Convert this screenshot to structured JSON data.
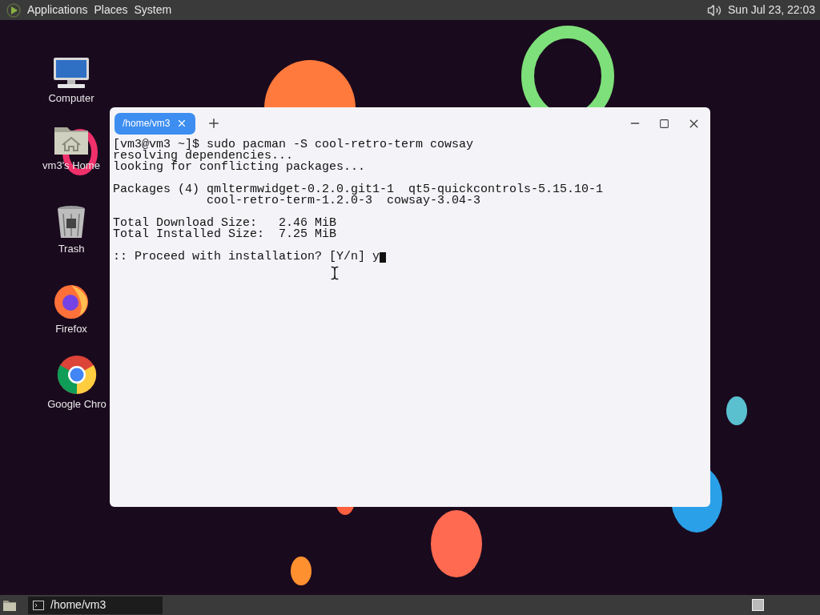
{
  "top_panel": {
    "menus": [
      "Applications",
      "Places",
      "System"
    ],
    "clock": "Sun Jul 23, 22:03"
  },
  "desktop_icons": [
    {
      "kind": "computer",
      "label": "Computer"
    },
    {
      "kind": "home",
      "label": "vm3's Home"
    },
    {
      "kind": "trash",
      "label": "Trash"
    },
    {
      "kind": "firefox",
      "label": "Firefox"
    },
    {
      "kind": "chrome",
      "label": "Google Chro"
    }
  ],
  "terminal": {
    "tabs": [
      {
        "label": "/home/vm3",
        "selected": true
      }
    ],
    "blocks": [
      [
        "[vm3@vm3 ~]$ sudo pacman -S cool-retro-term cowsay",
        "resolving dependencies...",
        "looking for conflicting packages..."
      ],
      [
        "Packages (4) qmltermwidget-0.2.0.git1-1  qt5-quickcontrols-5.15.10-1",
        "             cool-retro-term-1.2.0-3  cowsay-3.04-3"
      ],
      [
        "Total Download Size:   2.46 MiB",
        "Total Installed Size:  7.25 MiB"
      ],
      [
        ":: Proceed with installation? [Y/n] y"
      ]
    ]
  },
  "taskbar": {
    "windows": [
      {
        "label": "/home/vm3",
        "selected": true
      }
    ]
  }
}
